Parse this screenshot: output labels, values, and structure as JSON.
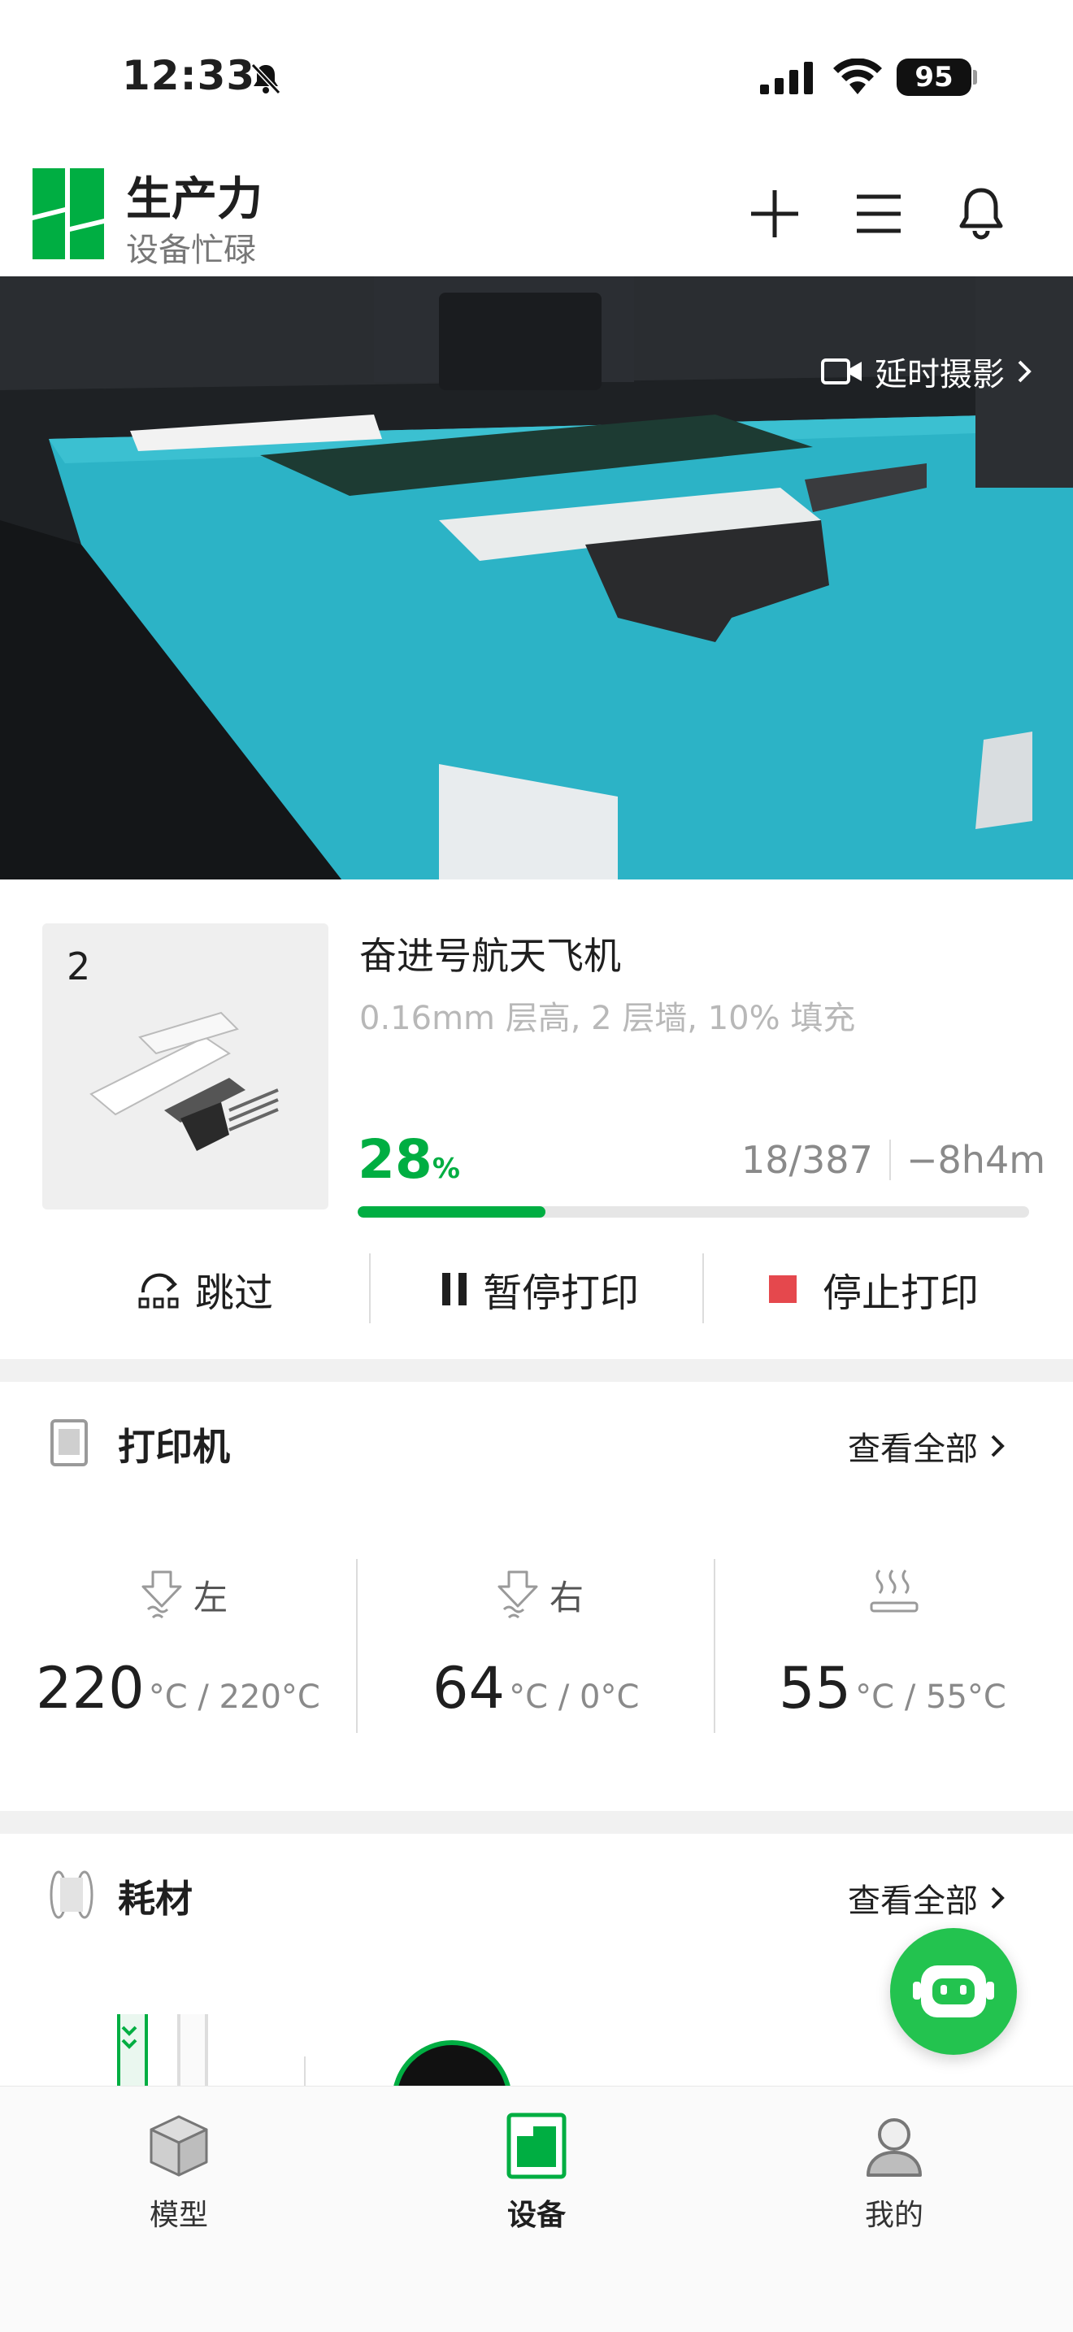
{
  "status_bar": {
    "time": "12:33",
    "battery": "95"
  },
  "header": {
    "title": "生产力",
    "subtitle": "设备忙碌"
  },
  "camera": {
    "timelapse_label": "延时摄影"
  },
  "job": {
    "thumbnail_count": "2",
    "name": "奋进号航天飞机",
    "params": "0.16mm 层高, 2 层墙, 10% 填充",
    "percent": "28",
    "percent_symbol": "%",
    "progress_fraction": 0.28,
    "layers": "18/387",
    "remaining": "−8h4m",
    "actions": {
      "skip": "跳过",
      "pause": "暂停打印",
      "stop": "停止打印"
    }
  },
  "printer": {
    "title": "打印机",
    "see_all": "查看全部",
    "temps": [
      {
        "label": "左",
        "current": "220",
        "target": "°C / 220°C"
      },
      {
        "label": "右",
        "current": "64",
        "target": "°C / 0°C"
      },
      {
        "label": "",
        "current": "55",
        "target": "°C / 55°C"
      }
    ]
  },
  "filament": {
    "title": "耗材",
    "see_all": "查看全部"
  },
  "tabs": [
    {
      "label": "模型",
      "active": false
    },
    {
      "label": "设备",
      "active": true
    },
    {
      "label": "我的",
      "active": false
    }
  ],
  "colors": {
    "accent": "#00ae42",
    "stop": "#e5484d",
    "bed": "#2cb3c6"
  }
}
